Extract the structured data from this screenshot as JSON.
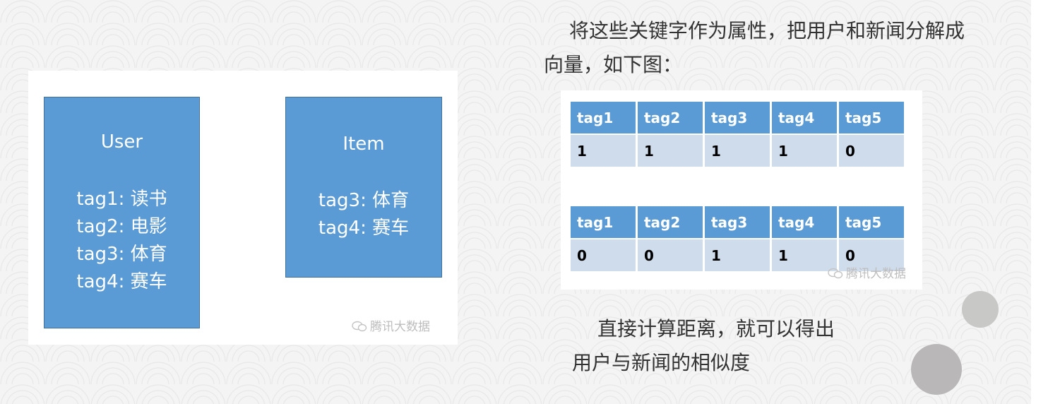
{
  "intro": {
    "line1": "将这些关键字作为属性，把用户和新闻分解成",
    "line2": "向量，如下图："
  },
  "user_box": {
    "title": "User",
    "tags": [
      "tag1: 读书",
      "tag2: 电影",
      "tag3: 体育",
      "tag4: 赛车"
    ]
  },
  "item_box": {
    "title": "Item",
    "tags": [
      "tag3: 体育",
      "tag4: 赛车"
    ]
  },
  "watermark": "腾讯大数据",
  "user_vector": {
    "headers": [
      "tag1",
      "tag2",
      "tag3",
      "tag4",
      "tag5"
    ],
    "values": [
      "1",
      "1",
      "1",
      "1",
      "0"
    ]
  },
  "item_vector": {
    "headers": [
      "tag1",
      "tag2",
      "tag3",
      "tag4",
      "tag5"
    ],
    "values": [
      "0",
      "0",
      "1",
      "1",
      "0"
    ]
  },
  "conclusion": {
    "line1": "直接计算距离，就可以得出",
    "line2": "用户与新闻的相似度"
  },
  "colors": {
    "box_fill": "#5b9bd5",
    "table_header": "#5b9bd5",
    "table_cell": "#cfdcec"
  }
}
